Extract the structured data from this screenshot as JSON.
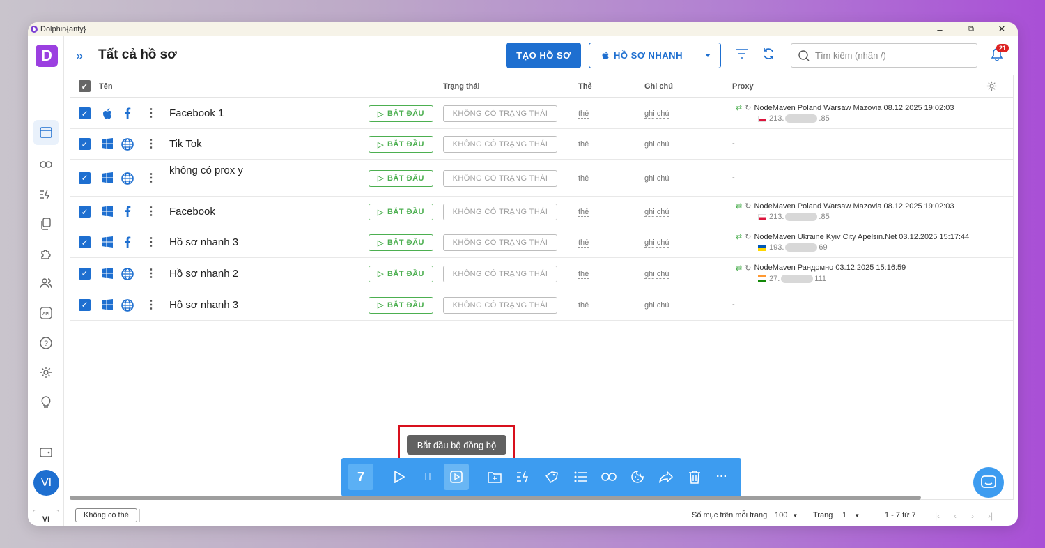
{
  "window": {
    "title": "Dolphin{anty}",
    "controls": [
      "–",
      "⧉",
      "✕"
    ]
  },
  "header": {
    "title": "Tất cả hồ sơ",
    "create_button": "TẠO HỒ SƠ",
    "quick_button": "HỒ SƠ NHANH",
    "search_placeholder": "Tìm kiếm (nhấn /)",
    "notification_count": "21"
  },
  "sidebar": {
    "logo": "D",
    "items": [
      "browser-profiles-icon",
      "link-icon",
      "automation-icon",
      "copy-icon",
      "extensions-icon",
      "users-icon",
      "api-icon",
      "help-icon",
      "settings-icon",
      "lightbulb-icon",
      "wallet-icon"
    ],
    "avatar": "VI",
    "language": "VI"
  },
  "table": {
    "headers": {
      "name": "Tên",
      "status": "Trạng thái",
      "tag": "Thẻ",
      "note": "Ghi chú",
      "proxy": "Proxy"
    },
    "rows": [
      {
        "os": "apple",
        "site": "facebook",
        "name": "Facebook 1",
        "start": "BẮT ĐẦU",
        "status": "KHÔNG CÓ TRẠNG THÁI",
        "tag": "thẻ",
        "note": "ghi chú",
        "proxy_name": "NodeMaven Poland Warsaw Mazovia 08.12.2025 19:02:03",
        "proxy_ip_start": "213.",
        "proxy_ip_end": ".85",
        "flag": "pl"
      },
      {
        "os": "windows",
        "site": "globe",
        "name": "Tik Tok",
        "start": "BẮT ĐẦU",
        "status": "KHÔNG CÓ TRẠNG THÁI",
        "tag": "thẻ",
        "note": "ghi chú",
        "proxy_name": "-"
      },
      {
        "os": "windows",
        "site": "globe",
        "name": "không có prox y",
        "start": "BẮT ĐẦU",
        "status": "KHÔNG CÓ TRẠNG THÁI",
        "tag": "thẻ",
        "note": "ghi chú",
        "proxy_name": "-"
      },
      {
        "os": "windows",
        "site": "facebook",
        "name": "Facebook",
        "start": "BẮT ĐẦU",
        "status": "KHÔNG CÓ TRẠNG THÁI",
        "tag": "thẻ",
        "note": "ghi chú",
        "proxy_name": "NodeMaven Poland Warsaw Mazovia 08.12.2025 19:02:03",
        "proxy_ip_start": "213.",
        "proxy_ip_end": ".85",
        "flag": "pl"
      },
      {
        "os": "windows",
        "site": "facebook",
        "name": "Hồ sơ nhanh 3",
        "start": "BẮT ĐẦU",
        "status": "KHÔNG CÓ TRẠNG THÁI",
        "tag": "thẻ",
        "note": "ghi chú",
        "proxy_name": "NodeMaven Ukraine Kyiv City Apelsin.Net 03.12.2025 15:17:44",
        "proxy_ip_start": "193.",
        "proxy_ip_end": "69",
        "flag": "ua"
      },
      {
        "os": "windows",
        "site": "globe",
        "name": "Hồ sơ nhanh 2",
        "start": "BẮT ĐẦU",
        "status": "KHÔNG CÓ TRẠNG THÁI",
        "tag": "thẻ",
        "note": "ghi chú",
        "proxy_name": "NodeMaven Рандомно 03.12.2025 15:16:59",
        "proxy_ip_start": "27.",
        "proxy_ip_end": "111",
        "flag": "in"
      },
      {
        "os": "windows",
        "site": "globe",
        "name": "Hồ sơ nhanh 3",
        "start": "BẮT ĐẦU",
        "status": "KHÔNG CÓ TRẠNG THÁI",
        "tag": "thẻ",
        "note": "ghi chú",
        "proxy_name": "-"
      }
    ]
  },
  "tooltip": "Bắt đầu bộ đồng bộ",
  "bulk_bar": {
    "selected_count": "7"
  },
  "footer": {
    "no_tag": "Không có thẻ",
    "per_page_label": "Số mục trên mỗi trang",
    "per_page_value": "100",
    "page_label": "Trang",
    "page_value": "1",
    "range": "1 - 7 từ 7"
  },
  "colors": {
    "accent": "#1e6fd0",
    "start_green": "#4caf50",
    "bulk_bar": "#3d9cf0",
    "highlight": "#d8101d",
    "logo": "#9b3fe0"
  }
}
